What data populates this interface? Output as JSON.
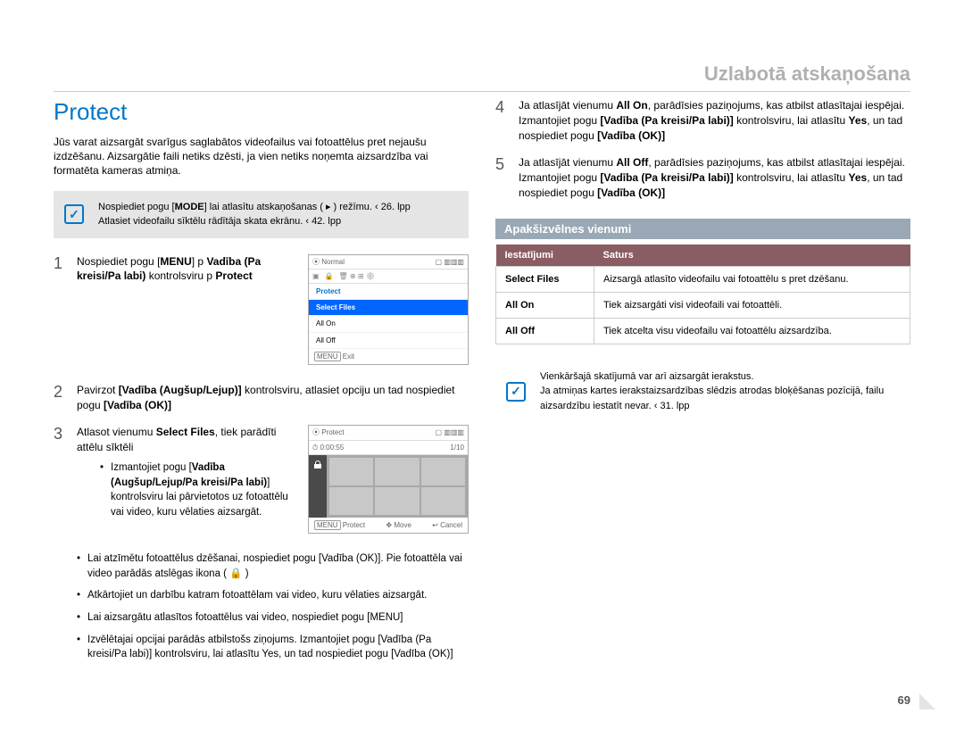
{
  "chapter_title": "Uzlabotā atskaņošana",
  "section_title": "Protect",
  "intro": "Jūs varat aizsargāt svarīgus saglabātos videofailus vai fotoattēlus pret nejaušu izdzēšanu. Aizsargātie faili netiks dzēsti, ja vien netiks noņemta aizsardzība vai formatēta kameras atmiņa.",
  "note1_line1_a": "Nospiediet pogu [",
  "note1_line1_mode": "MODE",
  "note1_line1_b": "] lai atlasītu atskaņošanas ( ▸ ) režīmu.  ‹ 26. lpp",
  "note1_line2": "Atlasiet videofailu sīktēlu rādītāja skata ekrānu.  ‹ 42. lpp",
  "steps": {
    "s1_a": "Nospiediet pogu [",
    "s1_menu": "MENU",
    "s1_b": "] p ",
    "s1_bold": "Vadība (Pa kreisi/Pa labi)",
    "s1_c": " kontrolsviru p ",
    "s1_protect": "Protect",
    "s2_a": "Pavirzot ",
    "s2_bold": "[Vadība (Augšup/Lejup)]",
    "s2_b": " kontrolsviru, atlasiet opciju un tad nospiediet pogu ",
    "s2_ok": "[Vadība (OK)]",
    "s3_a": "Atlasot vienumu ",
    "s3_sel": "Select Files",
    "s3_b": ", tiek parādīti attēlu sīktēli",
    "s3_sub1_a": "Izmantojiet pogu [",
    "s3_sub1_bold": "Vadība (Augšup/Lejup/Pa kreisi/Pa labi)",
    "s3_sub1_b": "] kontrolsviru lai pārvietotos uz fotoattēlu vai video, kuru vēlaties aizsargāt.",
    "s3_sub2": "Lai atzīmētu fotoattēlus dzēšanai, nospiediet pogu [Vadība (OK)]. Pie fotoattēla vai video parādās atslēgas ikona ( 🔒 )",
    "s3_sub3": "Atkārtojiet    un    darbību katram fotoattēlam vai video, kuru vēlaties aizsargāt.",
    "s3_sub4": "Lai aizsargātu atlasītos fotoattēlus vai video, nospiediet pogu [MENU]",
    "s3_sub5": "Izvēlētajai opcijai parādās atbilstošs ziņojums. Izmantojiet pogu [Vadība (Pa kreisi/Pa labi)] kontrolsviru, lai atlasītu Yes, un tad nospiediet pogu [Vadība (OK)]",
    "s4_a": "Ja atlasījāt vienumu ",
    "s4_allon": "All On",
    "s4_b": ", parādīsies paziņojums, kas atbilst atlasītajai iespējai. Izmantojiet pogu ",
    "s4_ctrl": "[Vadība (Pa kreisi/Pa labi)]",
    "s4_c": " kontrolsviru, lai atlasītu ",
    "s4_yes": "Yes",
    "s4_d": ", un tad nospiediet pogu ",
    "s4_ok": "[Vadība (OK)]",
    "s5_a": "Ja atlasījāt vienumu ",
    "s5_alloff": "All Off",
    "s5_b": ", parādīsies paziņojums, kas atbilst atlasītajai iespējai. Izmantojiet pogu ",
    "s5_ctrl": "[Vadība (Pa kreisi/Pa labi)]",
    "s5_c": " kontrolsviru, lai atlasītu ",
    "s5_yes": "Yes",
    "s5_d": ", un tad nospiediet pogu ",
    "s5_ok": "[Vadība (OK)]"
  },
  "lcd1": {
    "header_left": "⦿  Normal",
    "header_right": "▢ ▥▥▥",
    "r_protect": "Protect",
    "r_select": "Select Files",
    "r_allon": "All On",
    "r_alloff": "All Off",
    "footer_menu": "MENU",
    "footer_exit": "Exit"
  },
  "lcd2": {
    "header_left": "⦿  Protect",
    "header_right": "▢ ▥▥▥",
    "time": "0:00:55",
    "count": "1/10",
    "f_protect": "Protect",
    "f_move": "Move",
    "f_cancel": "Cancel"
  },
  "subheading": "Apakšizvēlnes vienumi",
  "table": {
    "h1": "Iestatījumi",
    "h2": "Saturs",
    "r1c1": "Select Files",
    "r1c2": "Aizsargā atlasīto videofailu vai fotoattēlu s pret dzēšanu.",
    "r2c1": "All On",
    "r2c2": "Tiek aizsargāti visi videofaili vai fotoattēli.",
    "r3c1": "All Off",
    "r3c2": "Tiek atcelta visu videofailu vai fotoattēlu aizsardzība."
  },
  "note2_line1": "Vienkāršajā skatījumā var arī aizsargāt ierakstus.",
  "note2_line2": "Ja atmiņas kartes ierakstaizsardzības slēdzis atrodas bloķēšanas pozīcijā, failu aizsardzību iestatīt nevar.  ‹ 31. lpp",
  "page_num": "69"
}
